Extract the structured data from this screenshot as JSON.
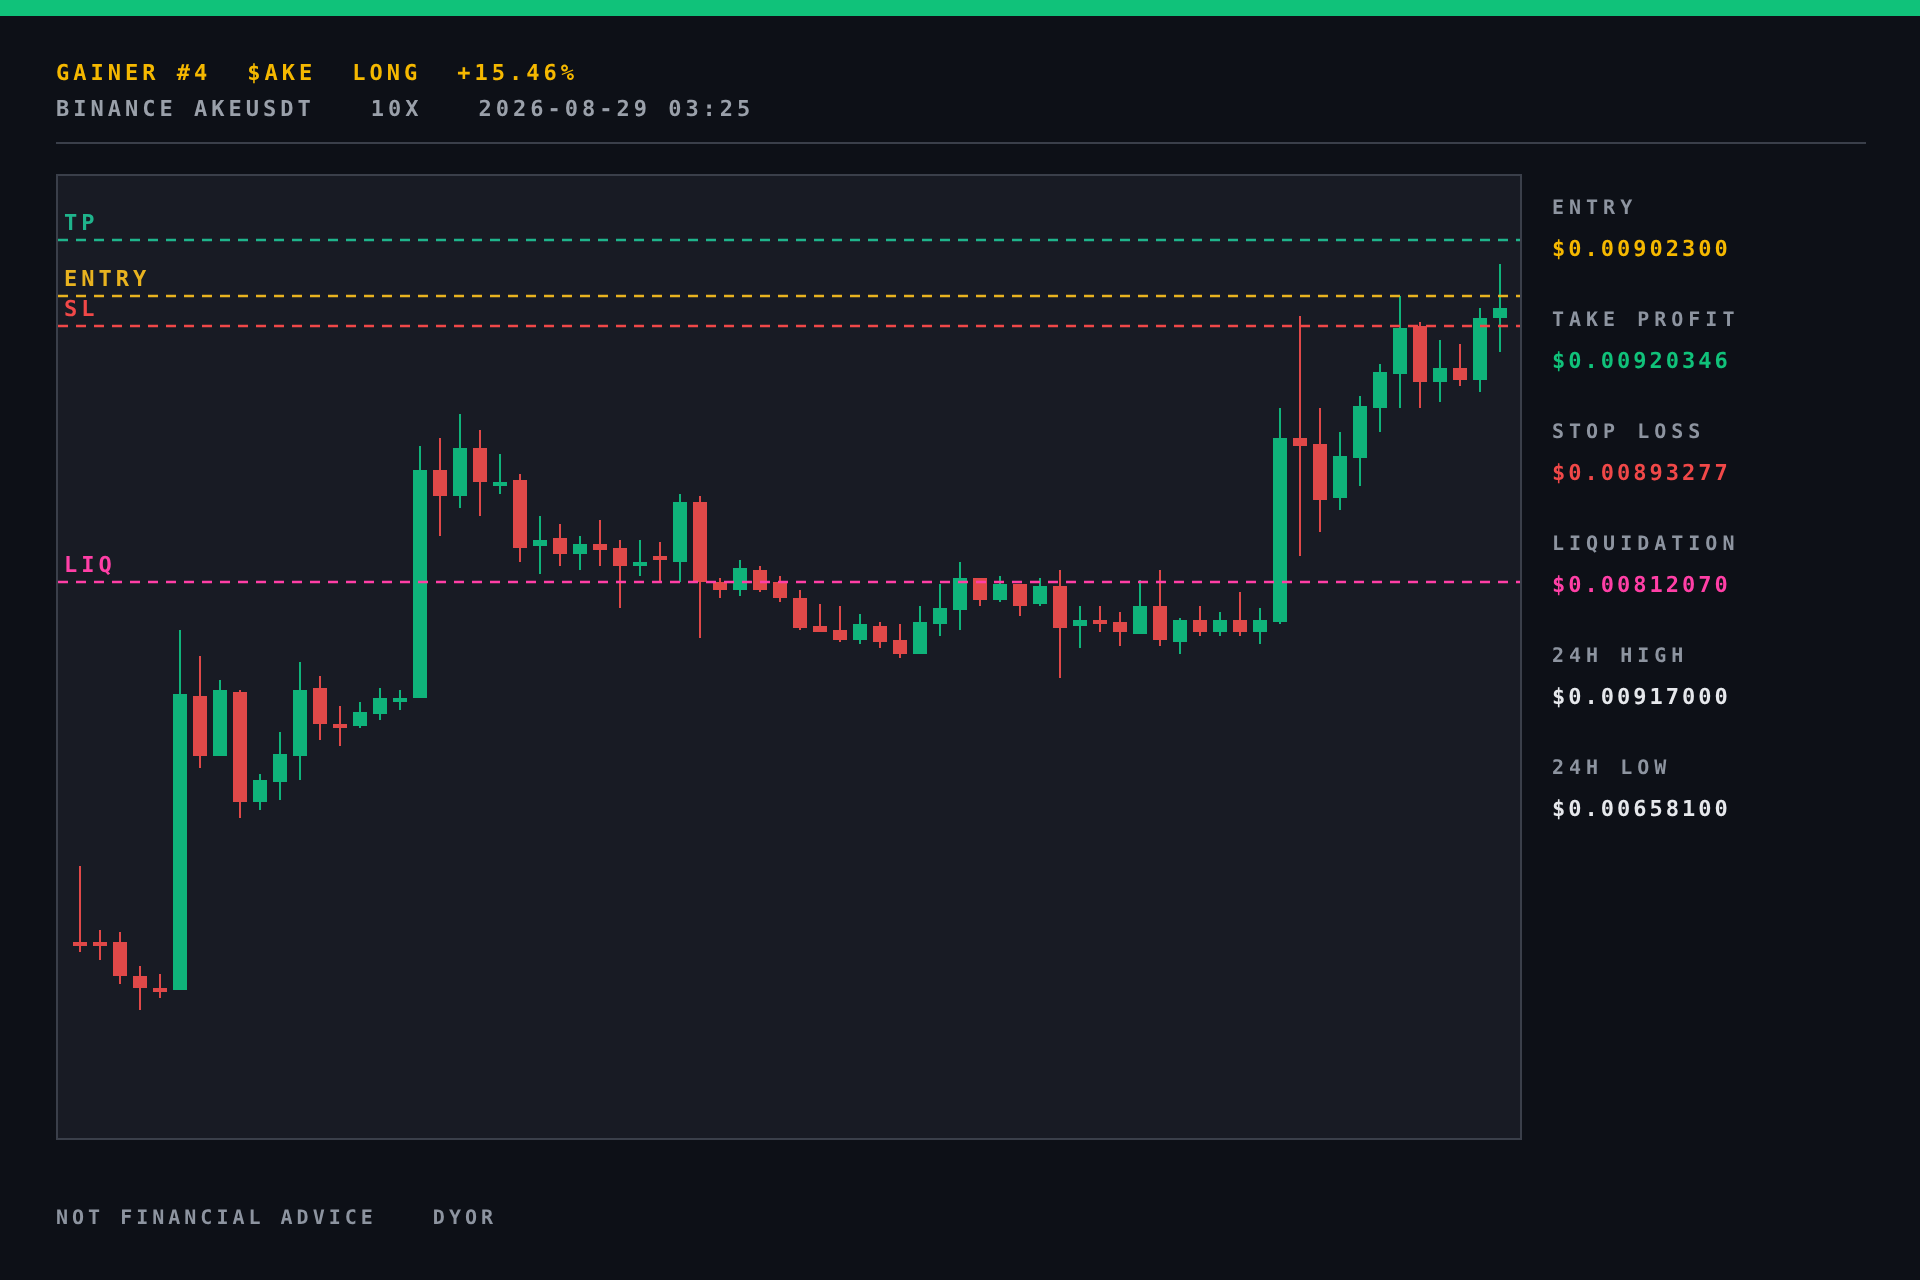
{
  "header": {
    "title": [
      "GAINER #4",
      "$AKE",
      "LONG",
      "+15.46%"
    ],
    "subtitle": [
      "BINANCE AKEUSDT",
      "10X",
      "2026-08-29 03:25"
    ]
  },
  "chart": {
    "levels": [
      {
        "kind": "tp",
        "label": "TP",
        "color": "#1fb48c"
      },
      {
        "kind": "entry",
        "label": "ENTRY",
        "color": "#e8b320"
      },
      {
        "kind": "sl",
        "label": "SL",
        "color": "#f04848"
      },
      {
        "kind": "liq",
        "label": "LIQ",
        "color": "#ff3fa6"
      }
    ]
  },
  "stats": [
    {
      "label": "ENTRY",
      "value": "$0.00902300",
      "color": "#f5b800"
    },
    {
      "label": "TAKE PROFIT",
      "value": "$0.00920346",
      "color": "#10c27a"
    },
    {
      "label": "STOP LOSS",
      "value": "$0.00893277",
      "color": "#f04848"
    },
    {
      "label": "LIQUIDATION",
      "value": "$0.00812070",
      "color": "#ff3fa6"
    },
    {
      "label": "24H HIGH",
      "value": "$0.00917000",
      "color": "#e6e8ec"
    },
    {
      "label": "24H LOW",
      "value": "$0.00658100",
      "color": "#e6e8ec"
    }
  ],
  "footer": [
    "NOT FINANCIAL ADVICE",
    "DYOR"
  ]
}
